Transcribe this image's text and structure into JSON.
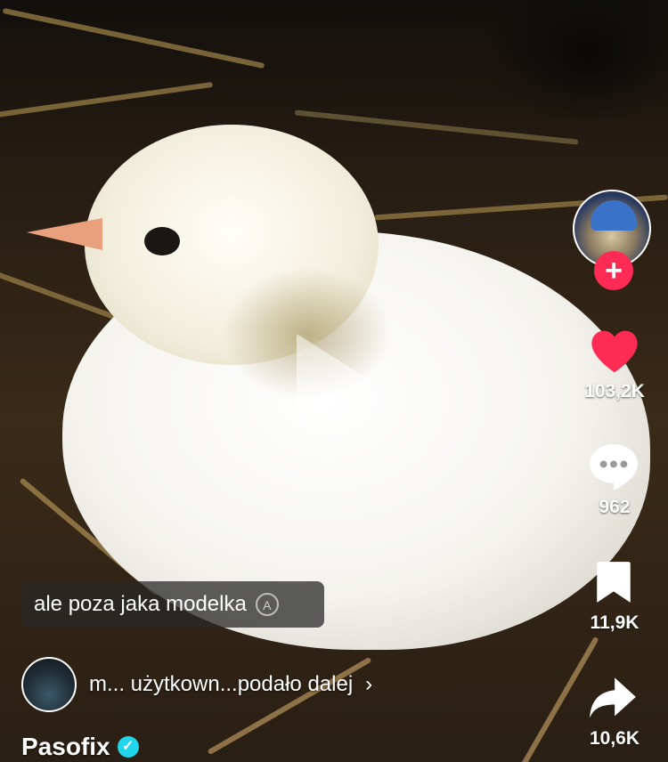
{
  "video": {
    "caption": "ale poza jaka modelka"
  },
  "sidebar": {
    "likes": "103,2K",
    "comments": "962",
    "saves": "11,9K",
    "shares": "10,6K",
    "like_color": "#fe2c55"
  },
  "repost": {
    "text": "m... użytkown...podało dalej"
  },
  "author": {
    "username": "Pasofix"
  },
  "icons": {
    "follow": "plus-icon",
    "like": "heart-icon",
    "comment": "comment-icon",
    "save": "bookmark-icon",
    "share": "share-icon",
    "verified": "verified-badge-icon",
    "translate": "translate-icon",
    "play": "play-icon"
  }
}
